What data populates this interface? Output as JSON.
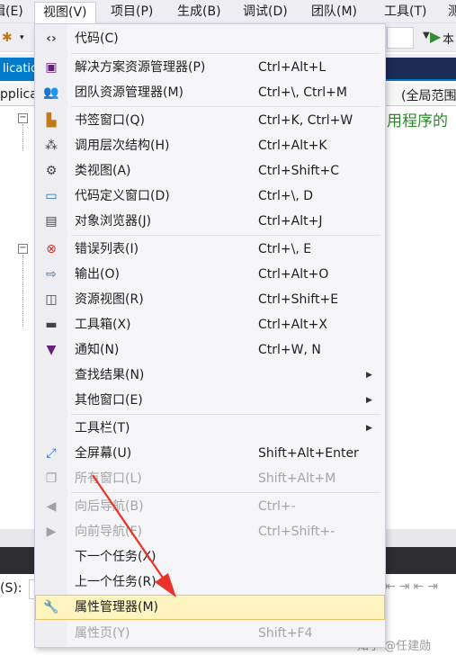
{
  "menubar": {
    "items": [
      {
        "label": "辑(E)"
      },
      {
        "label": "视图(V)"
      },
      {
        "label": "项目(P)"
      },
      {
        "label": "生成(B)"
      },
      {
        "label": "调试(D)"
      },
      {
        "label": "团队(M)"
      },
      {
        "label": "工具(T)"
      },
      {
        "label": "测"
      }
    ]
  },
  "toolbar": {
    "run_label": "本"
  },
  "tabs": {
    "doc_tab": "lication"
  },
  "navbar": {
    "left": "pplica",
    "right": "(全局范围"
  },
  "editor": {
    "comment": "用程序的"
  },
  "bottom_panel": {
    "find_label": "(S):"
  },
  "watermark": "知乎 @任建勋",
  "view_menu": {
    "items": [
      {
        "label": "代码(C)",
        "shortcut": "",
        "icon": "code-icon",
        "submenu": false,
        "disabled": false
      },
      {
        "label": "解决方案资源管理器(P)",
        "shortcut": "Ctrl+Alt+L",
        "icon": "solution-explorer-icon",
        "submenu": false,
        "disabled": false
      },
      {
        "label": "团队资源管理器(M)",
        "shortcut": "Ctrl+\\, Ctrl+M",
        "icon": "team-explorer-icon",
        "submenu": false,
        "disabled": false
      },
      {
        "label": "书签窗口(Q)",
        "shortcut": "Ctrl+K, Ctrl+W",
        "icon": "bookmark-icon",
        "submenu": false,
        "disabled": false
      },
      {
        "label": "调用层次结构(H)",
        "shortcut": "Ctrl+Alt+K",
        "icon": "call-hierarchy-icon",
        "submenu": false,
        "disabled": false
      },
      {
        "label": "类视图(A)",
        "shortcut": "Ctrl+Shift+C",
        "icon": "class-view-icon",
        "submenu": false,
        "disabled": false
      },
      {
        "label": "代码定义窗口(D)",
        "shortcut": "Ctrl+\\, D",
        "icon": "code-definition-icon",
        "submenu": false,
        "disabled": false
      },
      {
        "label": "对象浏览器(J)",
        "shortcut": "Ctrl+Alt+J",
        "icon": "object-browser-icon",
        "submenu": false,
        "disabled": false
      },
      {
        "label": "错误列表(I)",
        "shortcut": "Ctrl+\\, E",
        "icon": "error-list-icon",
        "submenu": false,
        "disabled": false
      },
      {
        "label": "输出(O)",
        "shortcut": "Ctrl+Alt+O",
        "icon": "output-icon",
        "submenu": false,
        "disabled": false
      },
      {
        "label": "资源视图(R)",
        "shortcut": "Ctrl+Shift+E",
        "icon": "resource-view-icon",
        "submenu": false,
        "disabled": false
      },
      {
        "label": "工具箱(X)",
        "shortcut": "Ctrl+Alt+X",
        "icon": "toolbox-icon",
        "submenu": false,
        "disabled": false
      },
      {
        "label": "通知(N)",
        "shortcut": "Ctrl+W, N",
        "icon": "notification-icon",
        "submenu": false,
        "disabled": false
      },
      {
        "label": "查找结果(N)",
        "shortcut": "",
        "icon": "",
        "submenu": true,
        "disabled": false
      },
      {
        "label": "其他窗口(E)",
        "shortcut": "",
        "icon": "",
        "submenu": true,
        "disabled": false
      },
      {
        "label": "工具栏(T)",
        "shortcut": "",
        "icon": "",
        "submenu": true,
        "disabled": false
      },
      {
        "label": "全屏幕(U)",
        "shortcut": "Shift+Alt+Enter",
        "icon": "fullscreen-icon",
        "submenu": false,
        "disabled": false
      },
      {
        "label": "所有窗口(L)",
        "shortcut": "Shift+Alt+M",
        "icon": "all-windows-icon",
        "submenu": false,
        "disabled": true
      },
      {
        "label": "向后导航(B)",
        "shortcut": "Ctrl+-",
        "icon": "navigate-back-icon",
        "submenu": false,
        "disabled": true
      },
      {
        "label": "向前导航(F)",
        "shortcut": "Ctrl+Shift+-",
        "icon": "navigate-forward-icon",
        "submenu": false,
        "disabled": true
      },
      {
        "label": "下一个任务(X)",
        "shortcut": "",
        "icon": "",
        "submenu": false,
        "disabled": false
      },
      {
        "label": "上一个任务(R)",
        "shortcut": "",
        "icon": "",
        "submenu": false,
        "disabled": false
      },
      {
        "label": "属性管理器(M)",
        "shortcut": "",
        "icon": "wrench-icon",
        "submenu": false,
        "disabled": false,
        "highlighted": true
      },
      {
        "label": "属性页(Y)",
        "shortcut": "Shift+F4",
        "icon": "",
        "submenu": false,
        "disabled": true
      }
    ]
  },
  "colors": {
    "accent": "#007acc",
    "highlight_bg": "#fdf4bf",
    "highlight_border": "#e5c365",
    "annotation_arrow": "#e8322a",
    "comment_green": "#2a8a2a"
  }
}
